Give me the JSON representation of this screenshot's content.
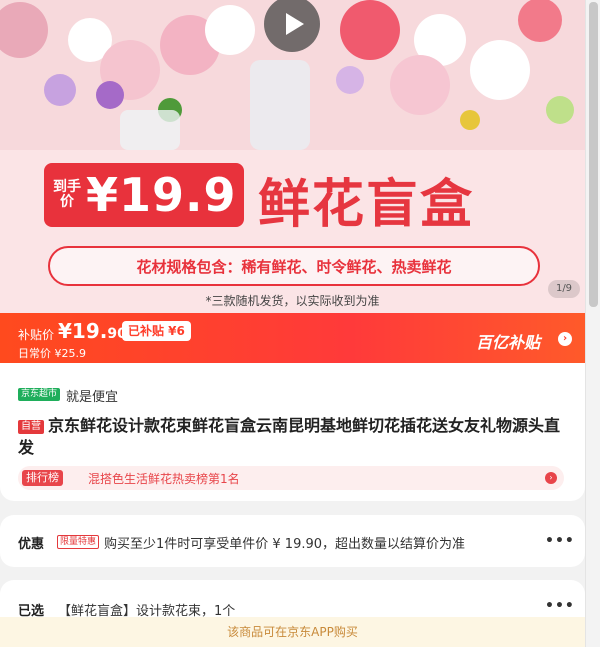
{
  "hero": {
    "badge_small": "到手价",
    "badge_price": "¥19.9",
    "headline": "鲜花盲盒",
    "spec": "花材规格包含：稀有鲜花、时令鲜花、热卖鲜花",
    "note": "*三款随机发货，以实际收到为准",
    "pager": "1/9"
  },
  "price_bar": {
    "label": "补贴价",
    "price_int": "¥19.",
    "price_dec": "90",
    "tag": "已补贴 ¥6",
    "daily": "日常价 ¥25.9",
    "brand": "百亿补贴",
    "arrow": "›"
  },
  "product": {
    "shop_tag": "京东超市",
    "shop_slogan": "就是便宜",
    "self_tag": "自营",
    "title": "京东鲜花设计款花束鲜花盲盒云南昆明基地鲜切花插花送女友礼物源头直发",
    "rank_tag": "排行榜",
    "rank_text": "混搭色生活鲜花热卖榜第1名",
    "rank_arrow": "›"
  },
  "promo": {
    "label": "优惠",
    "tag": "限量特惠",
    "text": "购买至少1件时可享受单件价 ¥ 19.90，超出数量以结算价为准",
    "more": "•••"
  },
  "selected": {
    "label": "已选",
    "text": "【鲜花盲盒】设计款花束，1个",
    "more": "•••"
  },
  "footer": {
    "text": "该商品可在京东APP购买"
  },
  "colors": {
    "accent": "#e8323c",
    "price_bar": "#ff4a1e",
    "footer_bg": "#fdf6e3",
    "footer_text": "#c88a3a"
  }
}
